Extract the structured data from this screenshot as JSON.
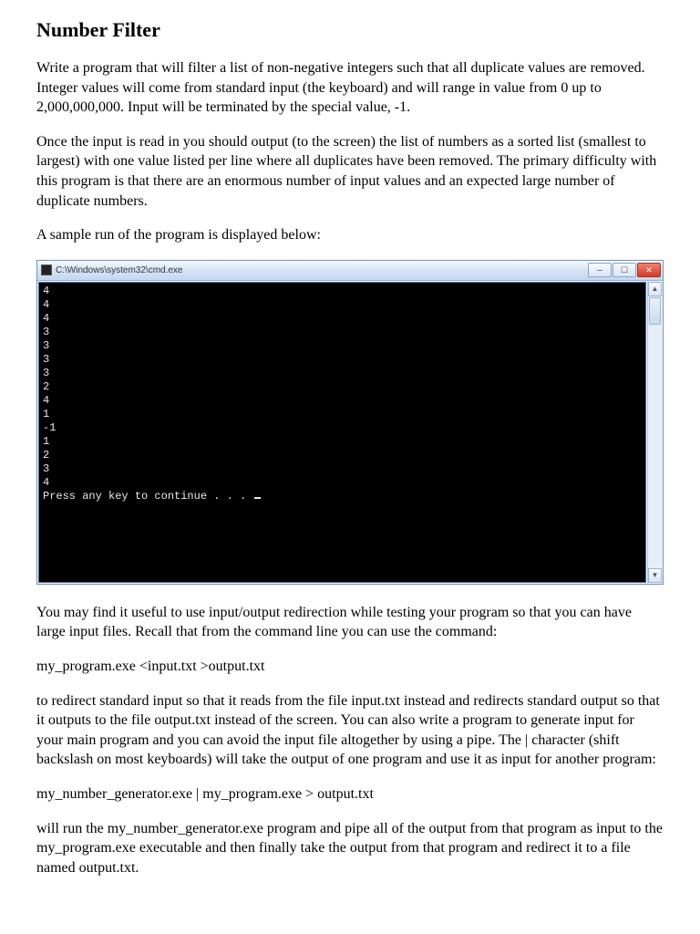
{
  "title": "Number Filter",
  "para1": "Write a program that will filter a list of non-negative integers such that all duplicate values are removed.  Integer values will come from standard input (the keyboard) and will range in value from 0 up to 2,000,000,000.  Input will be terminated by the special value, -1.",
  "para2": "Once the input is read in you should output (to the screen) the list of numbers as a sorted list (smallest to largest) with one value listed per line where all duplicates have been removed.  The primary difficulty with this program is that there are an enormous number of input values and an expected large number of duplicate numbers.",
  "para3": "A sample run of the program is displayed below:",
  "cmd": {
    "title": "C:\\Windows\\system32\\cmd.exe",
    "center": "",
    "output": "4\n4\n4\n3\n3\n3\n3\n2\n4\n1\n-1\n1\n2\n3\n4\nPress any key to continue . . . "
  },
  "para4": "You may find it useful to use input/output redirection while testing your program so that you can have large input files.  Recall that from the command line you can use the command:",
  "cmdline1": "my_program.exe  <input.txt    >output.txt",
  "para5": "to redirect standard input so that it reads from the file input.txt instead and redirects standard output so that it outputs to the file output.txt instead of the screen.  You can also write a program to generate input for your main program and you can avoid the input file altogether by using a pipe.  The | character (shift backslash on most keyboards) will take the output of one program and use it as input for another program:",
  "cmdline2": "my_number_generator.exe | my_program.exe > output.txt",
  "para6": "will run the my_number_generator.exe program and pipe all of the output from that program as input to the my_program.exe executable and then finally take the output from that program and redirect it to a file named output.txt."
}
